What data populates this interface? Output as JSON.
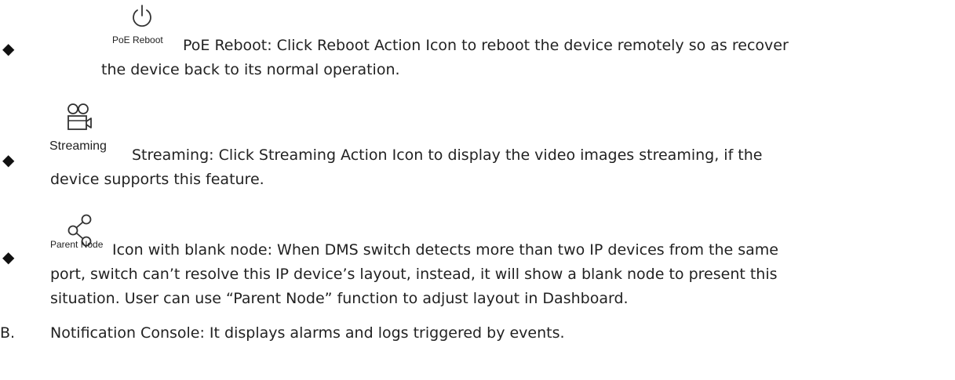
{
  "items": [
    {
      "icon": "power-icon",
      "caption": "PoE Reboot",
      "lines": [
        "PoE Reboot: Click Reboot Action Icon to reboot the device remotely so as recover",
        "the device back to its normal operation."
      ]
    },
    {
      "icon": "video-camera-icon",
      "caption": "Streaming",
      "lines": [
        "Streaming: Click Streaming Action Icon to display the video images streaming, if the",
        "device supports this feature."
      ]
    },
    {
      "icon": "share-node-icon",
      "caption": "Parent Node",
      "lines": [
        "Icon with blank node: When DMS switch detects more than two IP devices from the same",
        "port, switch can’t resolve this IP device’s layout, instead, it will show a blank node to present this",
        "situation. User can use “Parent Node” function to adjust layout in Dashboard."
      ]
    }
  ],
  "section_b": {
    "marker": "B.",
    "text": "Notification Console: It displays alarms and logs triggered by events."
  }
}
